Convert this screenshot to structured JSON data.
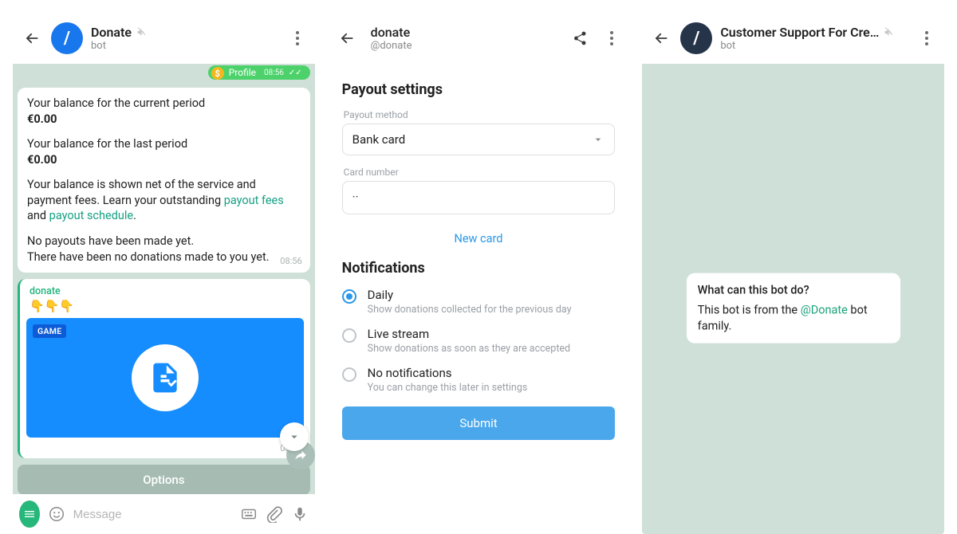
{
  "panel1": {
    "title": "Donate",
    "subtitle": "bot",
    "out_msg": {
      "label": "Profile",
      "time": "08:56"
    },
    "balance": {
      "line1": "Your balance for the current period",
      "val1": "€0.00",
      "line2": "Your balance for the last period",
      "val2": "€0.00",
      "explain_pre": "Your balance is shown net of the service and payment fees. Learn your outstanding ",
      "link1": "payout fees",
      "mid": " and ",
      "link2": "payout schedule",
      "dot": ".",
      "no_payouts": "No payouts have been made yet.",
      "no_donations": "There have been no donations made to you yet.",
      "ts": "08:56"
    },
    "media": {
      "source": "donate",
      "pointers": "👇👇👇",
      "tag": "GAME",
      "ts": "08:56"
    },
    "options_label": "Options",
    "composer_placeholder": "Message"
  },
  "panel2": {
    "title": "donate",
    "subtitle": "@donate",
    "section1": "Payout settings",
    "field_method_label": "Payout method",
    "field_method_value": "Bank card",
    "field_card_label": "Card number",
    "field_card_value": "··",
    "new_card": "New card",
    "section2": "Notifications",
    "options": [
      {
        "label": "Daily",
        "sub": "Show donations collected for the previous day",
        "selected": true
      },
      {
        "label": "Live stream",
        "sub": "Show donations as soon as they are accepted",
        "selected": false
      },
      {
        "label": "No notifications",
        "sub": "You can change this later in settings",
        "selected": false
      }
    ],
    "submit": "Submit"
  },
  "panel3": {
    "title": "Customer Support For Cre…",
    "subtitle": "bot",
    "info": {
      "question": "What can this bot do?",
      "text_pre": "This bot is from the ",
      "at": "@Donate",
      "text_post": " bot family."
    }
  }
}
